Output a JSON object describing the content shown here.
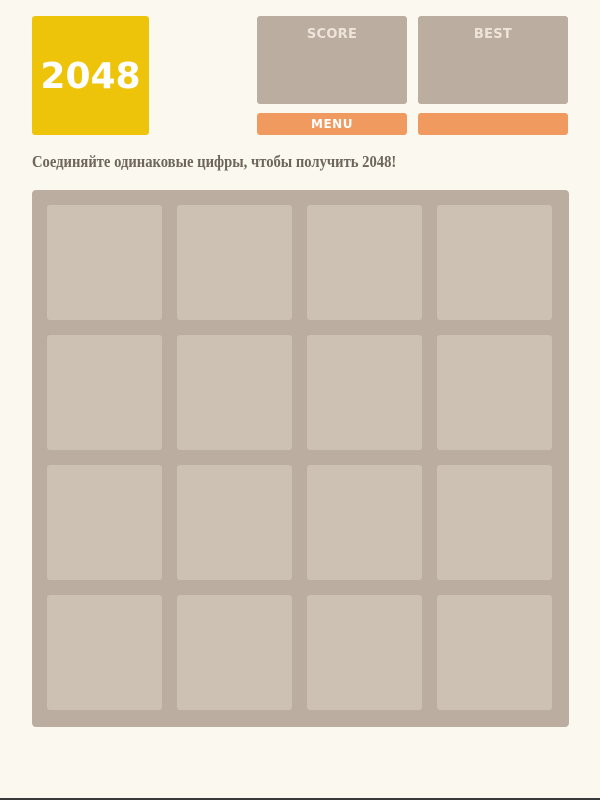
{
  "game": {
    "title": "2048",
    "score_label": "SCORE",
    "score_value": "",
    "best_label": "BEST",
    "best_value": "",
    "menu_label": "MENU",
    "second_button_label": "",
    "intro_text": "Соединяйте одинаковые цифры, чтобы получить 2048!"
  },
  "board": {
    "size": 4,
    "cells": [
      "",
      "",
      "",
      "",
      "",
      "",
      "",
      "",
      "",
      "",
      "",
      "",
      "",
      "",
      "",
      ""
    ]
  },
  "colors": {
    "background": "#faf8ef",
    "logo": "#edc40a",
    "score_box": "#bbada0",
    "button": "#f09a5f",
    "board": "#bbada0",
    "empty_cell": "#cdc1b4",
    "intro_text": "#6e655b"
  }
}
